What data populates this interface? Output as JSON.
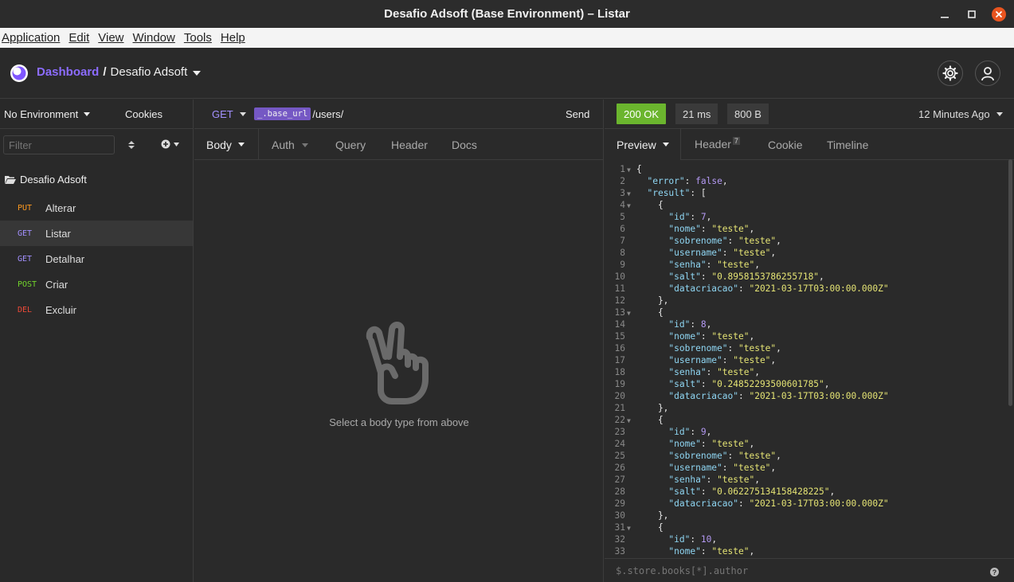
{
  "window": {
    "title": "Desafio Adsoft (Base Environment) – Listar"
  },
  "menu": [
    "Application",
    "Edit",
    "View",
    "Window",
    "Tools",
    "Help"
  ],
  "header": {
    "dashboard": "Dashboard",
    "separator": "/",
    "workspace": "Desafio Adsoft"
  },
  "sidebar": {
    "environment": "No Environment",
    "cookies": "Cookies",
    "filter_placeholder": "Filter",
    "folder": "Desafio Adsoft",
    "requests": [
      {
        "method": "PUT",
        "name": "Alterar",
        "color": "#ff9a1f"
      },
      {
        "method": "GET",
        "name": "Listar",
        "color": "#a390ff"
      },
      {
        "method": "GET",
        "name": "Detalhar",
        "color": "#a390ff"
      },
      {
        "method": "POST",
        "name": "Criar",
        "color": "#72d62b"
      },
      {
        "method": "DEL",
        "name": "Excluir",
        "color": "#ef4a38"
      }
    ]
  },
  "request": {
    "method": "GET",
    "url_var": "_.base_url",
    "url_path": "/users/",
    "send": "Send",
    "tabs": [
      "Body",
      "Auth",
      "Query",
      "Header",
      "Docs"
    ],
    "empty_message": "Select a body type from above"
  },
  "response": {
    "status": "200 OK",
    "time": "21 ms",
    "size": "800 B",
    "ago": "12 Minutes Ago",
    "tabs": [
      "Preview",
      "Header",
      "Cookie",
      "Timeline"
    ],
    "header_count": "7",
    "filter_placeholder": "$.store.books[*].author",
    "help": "?"
  },
  "colors": {
    "accent": "#7f56ff",
    "success": "#6bb52e"
  }
}
